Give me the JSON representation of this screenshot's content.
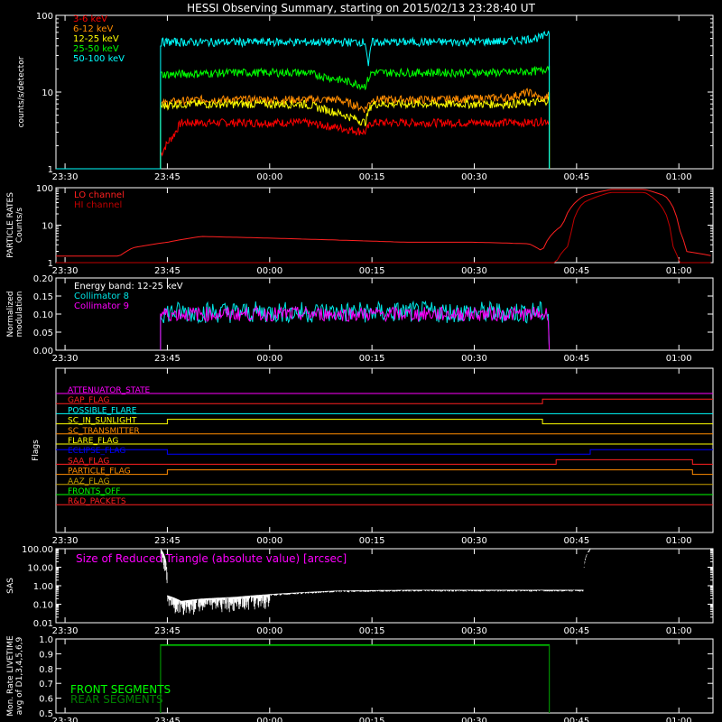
{
  "title": "HESSI Observing Summary, starting on 2015/02/13 23:28:40 UT",
  "x_axis": {
    "range": [
      "23:28:40",
      "01:05:00"
    ],
    "tick_labels": [
      "23:30",
      "23:45",
      "00:00",
      "00:15",
      "00:30",
      "00:45",
      "01:00"
    ]
  },
  "chart_data": [
    {
      "id": "counts",
      "type": "line",
      "ylabel": "counts/s/detector",
      "yscale": "log",
      "ylim": [
        1,
        100
      ],
      "ytick_labels": [
        "1",
        "10",
        "100"
      ],
      "legend_placement": "top-left",
      "series": [
        {
          "name": "3-6 keV",
          "color": "#ff0000",
          "data_start": "23:44",
          "data_end": "00:41",
          "x": [
            "23:44",
            "23:46",
            "23:47",
            "23:55",
            "00:05",
            "00:14",
            "00:15",
            "00:20",
            "00:30",
            "00:38",
            "00:40",
            "00:41"
          ],
          "y": [
            1.5,
            2.8,
            4,
            4,
            4,
            3,
            4,
            4,
            4,
            4,
            4.2,
            4.2
          ]
        },
        {
          "name": "6-12 keV",
          "color": "#ff8c00",
          "data_start": "23:44",
          "data_end": "00:41",
          "x": [
            "23:44",
            "23:46",
            "23:50",
            "00:00",
            "00:10",
            "00:14",
            "00:15",
            "00:25",
            "00:35",
            "00:38",
            "00:40",
            "00:41"
          ],
          "y": [
            7,
            7.5,
            8,
            8,
            8,
            6,
            8,
            8,
            8.5,
            10,
            8,
            9
          ]
        },
        {
          "name": "12-25 keV",
          "color": "#ffff00",
          "data_start": "23:44",
          "data_end": "00:41",
          "x": [
            "23:44",
            "23:46",
            "23:55",
            "00:05",
            "00:14",
            "00:15",
            "00:25",
            "00:35",
            "00:40",
            "00:41"
          ],
          "y": [
            6.5,
            7,
            7,
            7,
            4,
            7,
            7,
            7,
            7.5,
            8
          ]
        },
        {
          "name": "25-50 keV",
          "color": "#00ff00",
          "data_start": "23:44",
          "data_end": "00:41",
          "x": [
            "23:44",
            "23:45",
            "23:55",
            "00:05",
            "00:14",
            "00:15",
            "00:25",
            "00:35",
            "00:40",
            "00:41"
          ],
          "y": [
            17,
            17,
            18,
            18,
            12,
            18,
            18,
            18,
            19,
            22
          ]
        },
        {
          "name": "50-100 keV",
          "color": "#00ffff",
          "data_start": "23:44",
          "data_end": "00:41",
          "x": [
            "23:44",
            "23:45",
            "23:55",
            "00:05",
            "00:14",
            "00:14:30",
            "00:15",
            "00:25",
            "00:35",
            "00:40",
            "00:41"
          ],
          "y": [
            45,
            45,
            45,
            45,
            45,
            20,
            45,
            45,
            46,
            52,
            62
          ]
        }
      ]
    },
    {
      "id": "particle",
      "type": "line",
      "ylabel": "PARTICLE RATES Counts/s",
      "yscale": "log",
      "ylim": [
        1,
        100
      ],
      "ytick_labels": [
        "1",
        "10",
        "100"
      ],
      "legend_placement": "top-left",
      "series": [
        {
          "name": "LO channel",
          "color": "#ff2020",
          "x": [
            "23:28:40",
            "23:38",
            "23:40",
            "23:45",
            "23:50",
            "00:00",
            "00:10",
            "00:20",
            "00:30",
            "00:38",
            "00:40",
            "00:43",
            "00:46",
            "00:50",
            "00:55",
            "00:58",
            "01:00",
            "01:01",
            "01:05"
          ],
          "y": [
            1.5,
            1.5,
            2.5,
            3.5,
            5,
            4.5,
            4,
            3.5,
            3.5,
            3.2,
            2,
            10,
            60,
            90,
            90,
            60,
            8,
            2,
            1.5
          ]
        },
        {
          "name": "HI channel",
          "color": "#c00000",
          "x": [
            "23:28:40",
            "00:42",
            "00:44",
            "00:46",
            "00:50",
            "00:55",
            "00:57",
            "00:59",
            "01:00",
            "01:05"
          ],
          "y": [
            1,
            1,
            3,
            40,
            75,
            75,
            40,
            3,
            1,
            1
          ]
        }
      ]
    },
    {
      "id": "modulation",
      "type": "line",
      "ylabel": "Normalized modulation",
      "ylim": [
        0,
        0.2
      ],
      "ytick_labels": [
        "0.00",
        "0.05",
        "0.10",
        "0.15",
        "0.20"
      ],
      "annotation": "Energy band: 12-25 keV",
      "legend_placement": "top-left",
      "series": [
        {
          "name": "Collimator 8",
          "color": "#00e5e5",
          "data_start": "23:44",
          "data_end": "00:41",
          "mean": 0.105,
          "spread": 0.06
        },
        {
          "name": "Collimator 9",
          "color": "#ff00ff",
          "data_start": "23:44",
          "data_end": "00:41",
          "mean": 0.1,
          "spread": 0.04
        }
      ]
    },
    {
      "id": "flags",
      "type": "line",
      "ylabel": "Flags",
      "series": [
        {
          "name": "ATTENUATOR_STATE",
          "color": "#ff00ff",
          "segments": [
            [
              "23:28:40",
              "01:05",
              0
            ]
          ]
        },
        {
          "name": "GAP_FLAG",
          "color": "#ff2020",
          "segments": [
            [
              "23:28:40",
              "00:40",
              0
            ],
            [
              "00:40",
              "01:05",
              1
            ]
          ]
        },
        {
          "name": "POSSIBLE_FLARE",
          "color": "#00ffff",
          "segments": [
            [
              "23:28:40",
              "01:05",
              0
            ]
          ]
        },
        {
          "name": "SC_IN_SUNLIGHT",
          "color": "#ffff00",
          "segments": [
            [
              "23:28:40",
              "23:45",
              0
            ],
            [
              "23:45",
              "00:40",
              1
            ],
            [
              "00:40",
              "01:05",
              0
            ]
          ]
        },
        {
          "name": "SC_TRANSMITTER",
          "color": "#ff8c00",
          "segments": [
            [
              "23:28:40",
              "01:05",
              0
            ]
          ]
        },
        {
          "name": "FLARE_FLAG",
          "color": "#ffff00",
          "segments": [
            [
              "23:28:40",
              "01:05",
              0
            ]
          ]
        },
        {
          "name": "ECLIPSE_FLAG",
          "color": "#0000ff",
          "segments": [
            [
              "23:28:40",
              "23:45",
              1
            ],
            [
              "23:45",
              "00:47",
              0
            ],
            [
              "00:47",
              "01:05",
              1
            ]
          ]
        },
        {
          "name": "SAA_FLAG",
          "color": "#ff2020",
          "segments": [
            [
              "23:28:40",
              "00:42",
              0
            ],
            [
              "00:42",
              "01:02",
              1
            ],
            [
              "01:02",
              "01:05",
              0
            ]
          ]
        },
        {
          "name": "PARTICLE_FLAG",
          "color": "#ff8c00",
          "segments": [
            [
              "23:28:40",
              "23:45",
              0
            ],
            [
              "23:45",
              "01:02",
              1
            ],
            [
              "01:02",
              "01:05",
              0
            ]
          ]
        },
        {
          "name": "AAZ_FLAG",
          "color": "#c8a000",
          "segments": [
            [
              "23:28:40",
              "01:05",
              0
            ]
          ]
        },
        {
          "name": "FRONTS_OFF",
          "color": "#00ff00",
          "segments": [
            [
              "23:28:40",
              "01:05",
              0
            ]
          ]
        },
        {
          "name": "R&D_PACKETS",
          "color": "#ff2020",
          "segments": [
            [
              "23:28:40",
              "01:05",
              0
            ]
          ]
        }
      ]
    },
    {
      "id": "sas",
      "type": "line",
      "ylabel": "SAS",
      "yscale": "log",
      "ylim": [
        0.01,
        100
      ],
      "ytick_labels": [
        "0.01",
        "0.10",
        "1.00",
        "10.00",
        "100.00"
      ],
      "annotation": "Size of Reduced Triangle (absolute value) [arcsec]",
      "series": [
        {
          "name": "",
          "color": "#ffffff",
          "x": [
            "23:44",
            "23:45",
            "23:47",
            "23:50",
            "23:55",
            "00:00",
            "00:05",
            "00:10",
            "00:20",
            "00:30",
            "00:40",
            "00:46",
            "00:47"
          ],
          "y": [
            100,
            0.3,
            0.15,
            0.2,
            0.25,
            0.35,
            0.45,
            0.55,
            0.6,
            0.6,
            0.6,
            0.6,
            100
          ]
        }
      ]
    },
    {
      "id": "livetime",
      "type": "line",
      "ylabel": "Mon. Rate LIVETIME avg of D1,3,4,5,6,9",
      "ylim": [
        0.5,
        1.0
      ],
      "ytick_labels": [
        "0.5",
        "0.6",
        "0.7",
        "0.8",
        "0.9",
        "1.0"
      ],
      "legend_placement": "bottom-left",
      "series": [
        {
          "name": "FRONT SEGMENTS",
          "color": "#00ff00",
          "x": [
            "23:44",
            "23:44",
            "00:41",
            "00:41"
          ],
          "y": [
            0.5,
            0.96,
            0.96,
            0.5
          ]
        },
        {
          "name": "REAR SEGMENTS",
          "color": "#008000",
          "x": [
            "23:44",
            "23:44",
            "00:41",
            "00:41"
          ],
          "y": [
            0.5,
            0.955,
            0.955,
            0.5
          ]
        }
      ]
    }
  ]
}
